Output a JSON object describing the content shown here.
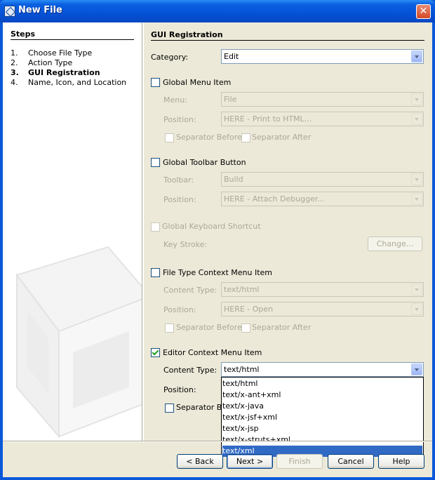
{
  "window": {
    "title": "New File"
  },
  "steps": {
    "title": "Steps",
    "items": [
      {
        "num": "1.",
        "label": "Choose File Type"
      },
      {
        "num": "2.",
        "label": "Action Type"
      },
      {
        "num": "3.",
        "label": "GUI Registration"
      },
      {
        "num": "4.",
        "label": "Name, Icon, and Location"
      }
    ],
    "current_index": 2
  },
  "gui": {
    "title": "GUI Registration",
    "category": {
      "label": "Category:",
      "value": "Edit"
    },
    "global_menu": {
      "label": "Global Menu Item",
      "checked": false,
      "menu_label": "Menu:",
      "menu_value": "File",
      "position_label": "Position:",
      "position_value": "HERE - Print to HTML...",
      "sep_before": "Separator Before",
      "sep_after": "Separator After"
    },
    "global_toolbar": {
      "label": "Global Toolbar Button",
      "checked": false,
      "toolbar_label": "Toolbar:",
      "toolbar_value": "Build",
      "position_label": "Position:",
      "position_value": "HERE - Attach Debugger..."
    },
    "global_shortcut": {
      "label": "Global Keyboard Shortcut",
      "checked": false,
      "keystroke_label": "Key Stroke:",
      "change_button": "Change..."
    },
    "file_type_context": {
      "label": "File Type Context Menu Item",
      "checked": false,
      "content_type_label": "Content Type:",
      "content_type_value": "text/html",
      "position_label": "Position:",
      "position_value": "HERE - Open",
      "sep_before": "Separator Before",
      "sep_after": "Separator After"
    },
    "editor_context": {
      "label": "Editor Context Menu Item",
      "checked": true,
      "content_type_label": "Content Type:",
      "content_type_value": "text/html",
      "position_label": "Position:",
      "sep_before_partial": "Separator Be",
      "dropdown_options": [
        "text/html",
        "text/x-ant+xml",
        "text/x-java",
        "text/x-jsf+xml",
        "text/x-jsp",
        "text/x-struts+xml",
        "text/xml"
      ],
      "highlighted_option": "text/xml"
    }
  },
  "buttons": {
    "back": "< Back",
    "next": "Next >",
    "finish": "Finish",
    "cancel": "Cancel",
    "help": "Help"
  },
  "colors": {
    "titlebar": "#0a5fe0",
    "selection": "#316ac5",
    "dialog_bg": "#ece9d8",
    "close_button": "#d24a26"
  }
}
